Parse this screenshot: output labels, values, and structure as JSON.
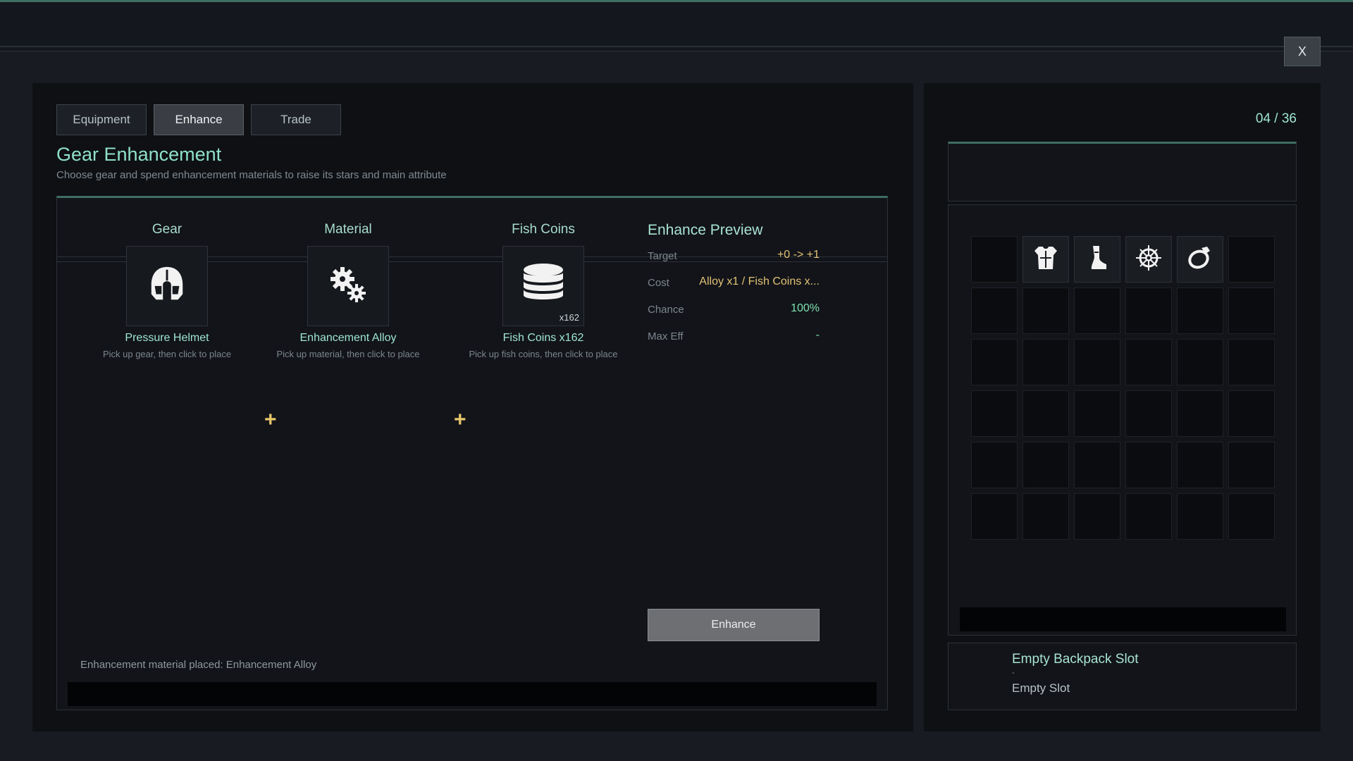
{
  "window": {
    "close_label": "X"
  },
  "tabs": [
    {
      "label": "Equipment",
      "active": false
    },
    {
      "label": "Enhance",
      "active": true
    },
    {
      "label": "Trade",
      "active": false
    }
  ],
  "header": {
    "title": "Gear Enhancement",
    "subtitle": "Choose gear and spend enhancement materials to raise its stars and main attribute"
  },
  "slots": {
    "gear": {
      "title": "Gear",
      "item_name": "Pressure Helmet",
      "hint": "Pick up gear, then click to place",
      "icon": "helmet-icon"
    },
    "material": {
      "title": "Material",
      "item_name": "Enhancement Alloy",
      "hint": "Pick up material, then click to place",
      "icon": "gears-icon"
    },
    "coins": {
      "title": "Fish Coins",
      "item_name": "Fish Coins x162",
      "hint": "Pick up fish coins, then click to place",
      "quantity": "x162",
      "icon": "coin-stack-icon"
    }
  },
  "plus_symbol": "+",
  "preview": {
    "title": "Enhance Preview",
    "rows": [
      {
        "label": "Target",
        "value": "+0 -> +1"
      },
      {
        "label": "Cost",
        "value": "Alloy x1 / Fish Coins x..."
      },
      {
        "label": "Chance",
        "value": "100%"
      },
      {
        "label": "Max Eff",
        "value": "-"
      }
    ]
  },
  "enhance_button": "Enhance",
  "status_message": "Enhancement material placed: Enhancement Alloy",
  "inventory": {
    "counter": "04 / 36",
    "items": [
      "",
      "chestplate-icon",
      "boot-icon",
      "compass-icon",
      "ring-icon"
    ],
    "detail": {
      "title": "Empty Backpack Slot",
      "dash": "-",
      "subtitle": "Empty Slot"
    }
  },
  "colors": {
    "accent": "#8fe0c8",
    "highlight_gold": "#e2c275",
    "positive_green": "#7fe2b0",
    "panel_bg": "#0e1014"
  }
}
